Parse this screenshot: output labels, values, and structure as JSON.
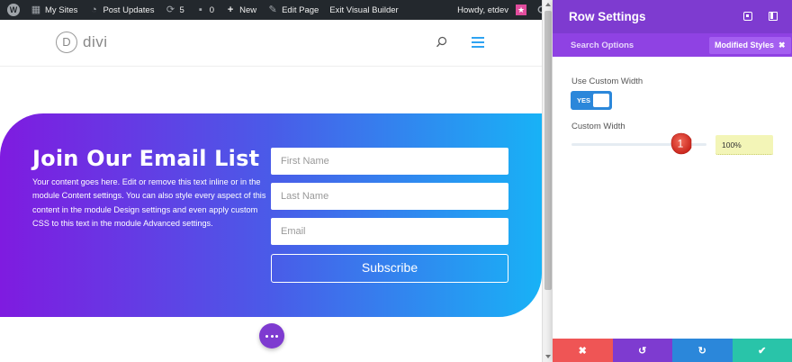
{
  "admin_bar": {
    "wp_logo": "W",
    "my_sites": "My Sites",
    "post_updates": "Post Updates",
    "updates_count": "5",
    "comments_count": "0",
    "new_label": "New",
    "edit_page": "Edit Page",
    "exit_builder": "Exit Visual Builder",
    "howdy": "Howdy, etdev"
  },
  "site": {
    "logo_letter": "D",
    "logo_text": "divi"
  },
  "hero": {
    "title": "Join Our Email List",
    "body": "Your content goes here. Edit or remove this text inline or in the module Content settings. You can also style every aspect of this content in the module Design settings and even apply custom CSS to this text in the module Advanced settings.",
    "fields": [
      {
        "placeholder": "First Name"
      },
      {
        "placeholder": "Last Name"
      },
      {
        "placeholder": "Email"
      }
    ],
    "button_label": "Subscribe"
  },
  "panel": {
    "title": "Row Settings",
    "search_options": "Search Options",
    "modified_styles": "Modified Styles",
    "use_custom_width_label": "Use Custom Width",
    "toggle_text": "YES",
    "custom_width_label": "Custom Width",
    "custom_width_value": "100%",
    "step_marker": "1"
  },
  "colors": {
    "accent_purple": "#7e3bd0",
    "accent_blue": "#2b87da",
    "cancel_red": "#ef5555",
    "save_green": "#29c4a9"
  }
}
